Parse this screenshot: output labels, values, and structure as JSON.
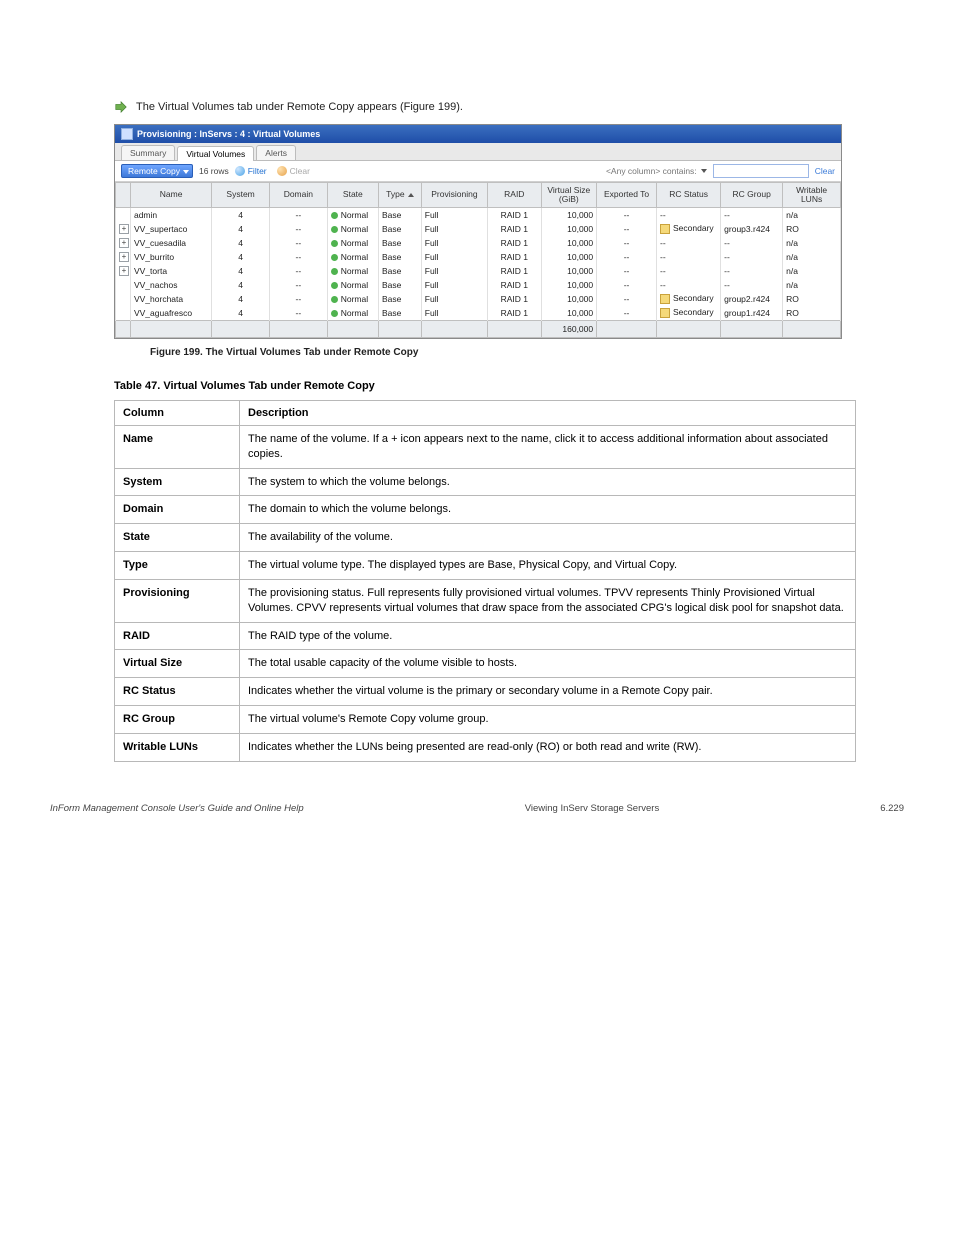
{
  "intro_text": "The Virtual Volumes tab under Remote Copy appears (Figure 199).",
  "screenshot": {
    "title": "Provisioning : InServs : 4 : Virtual Volumes",
    "tabs": [
      "Summary",
      "Virtual Volumes",
      "Alerts"
    ],
    "active_tab": 1,
    "toolbar": {
      "dropdown": "Remote Copy",
      "row_count": "16 rows",
      "filter_label": "Filter",
      "clear_label": "Clear",
      "search_label": "<Any column> contains:",
      "search_value": "",
      "clear_link": "Clear"
    },
    "columns": [
      "",
      "Name",
      "System",
      "Domain",
      "State",
      "Type",
      "Provisioning",
      "RAID",
      "Virtual Size (GiB)",
      "Exported To",
      "RC Status",
      "RC Group",
      "Writable LUNs"
    ],
    "sorted_col": 5,
    "rows": [
      {
        "exp": "",
        "name": "admin",
        "system": "4",
        "domain": "--",
        "state": "Normal",
        "type": "Base",
        "prov": "Full",
        "raid": "RAID 1",
        "vsize": "10,000",
        "exported": "--",
        "rcstatus": "--",
        "rcgroup": "--",
        "wluns": "n/a"
      },
      {
        "exp": "+",
        "name": "VV_supertaco",
        "system": "4",
        "domain": "--",
        "state": "Normal",
        "type": "Base",
        "prov": "Full",
        "raid": "RAID 1",
        "vsize": "10,000",
        "exported": "--",
        "rcstatus": "Secondary",
        "rcgroup": "group3.r424",
        "wluns": "RO",
        "rc": true
      },
      {
        "exp": "+",
        "name": "VV_cuesadila",
        "system": "4",
        "domain": "--",
        "state": "Normal",
        "type": "Base",
        "prov": "Full",
        "raid": "RAID 1",
        "vsize": "10,000",
        "exported": "--",
        "rcstatus": "--",
        "rcgroup": "--",
        "wluns": "n/a"
      },
      {
        "exp": "+",
        "name": "VV_burrito",
        "system": "4",
        "domain": "--",
        "state": "Normal",
        "type": "Base",
        "prov": "Full",
        "raid": "RAID 1",
        "vsize": "10,000",
        "exported": "--",
        "rcstatus": "--",
        "rcgroup": "--",
        "wluns": "n/a"
      },
      {
        "exp": "+",
        "name": "VV_torta",
        "system": "4",
        "domain": "--",
        "state": "Normal",
        "type": "Base",
        "prov": "Full",
        "raid": "RAID 1",
        "vsize": "10,000",
        "exported": "--",
        "rcstatus": "--",
        "rcgroup": "--",
        "wluns": "n/a"
      },
      {
        "exp": "",
        "name": "VV_nachos",
        "system": "4",
        "domain": "--",
        "state": "Normal",
        "type": "Base",
        "prov": "Full",
        "raid": "RAID 1",
        "vsize": "10,000",
        "exported": "--",
        "rcstatus": "--",
        "rcgroup": "--",
        "wluns": "n/a"
      },
      {
        "exp": "",
        "name": "VV_horchata",
        "system": "4",
        "domain": "--",
        "state": "Normal",
        "type": "Base",
        "prov": "Full",
        "raid": "RAID 1",
        "vsize": "10,000",
        "exported": "--",
        "rcstatus": "Secondary",
        "rcgroup": "group2.r424",
        "wluns": "RO",
        "rc": true
      },
      {
        "exp": "",
        "name": "VV_aguafresco",
        "system": "4",
        "domain": "--",
        "state": "Normal",
        "type": "Base",
        "prov": "Full",
        "raid": "RAID 1",
        "vsize": "10,000",
        "exported": "--",
        "rcstatus": "Secondary",
        "rcgroup": "group1.r424",
        "wluns": "RO",
        "rc": true
      }
    ],
    "footer_total": "160,000"
  },
  "figure_caption": "Figure 199. The Virtual Volumes Tab under Remote Copy",
  "col_table": {
    "caption": "Table 47. Virtual Volumes Tab under Remote Copy",
    "head": [
      "Column",
      "Description"
    ],
    "rows": [
      [
        "Name",
        "The name of the volume. If a + icon appears next to the name, click it to access additional information about associated copies."
      ],
      [
        "System",
        "The system to which the volume belongs."
      ],
      [
        "Domain",
        "The domain to which the volume belongs."
      ],
      [
        "State",
        "The availability of the volume."
      ],
      [
        "Type",
        "The virtual volume type. The displayed types are Base, Physical Copy, and Virtual Copy."
      ],
      [
        "Provisioning",
        "The provisioning status. Full represents fully provisioned virtual volumes. TPVV represents Thinly Provisioned Virtual Volumes. CPVV represents virtual volumes that draw space from the associated CPG's logical disk pool for snapshot data."
      ],
      [
        "RAID",
        "The RAID type of the volume."
      ],
      [
        "Virtual Size",
        "The total usable capacity of the volume visible to hosts."
      ],
      [
        "RC Status",
        "Indicates whether the virtual volume is the primary or secondary volume in a Remote Copy pair."
      ],
      [
        "RC Group",
        "The virtual volume's Remote Copy volume group."
      ],
      [
        "Writable LUNs",
        "Indicates whether the LUNs being presented are read-only (RO) or both read and write (RW)."
      ]
    ]
  },
  "footer": {
    "left": "InForm Management Console User's Guide and Online Help",
    "center": "Viewing InServ Storage Servers",
    "right": "6.229"
  }
}
